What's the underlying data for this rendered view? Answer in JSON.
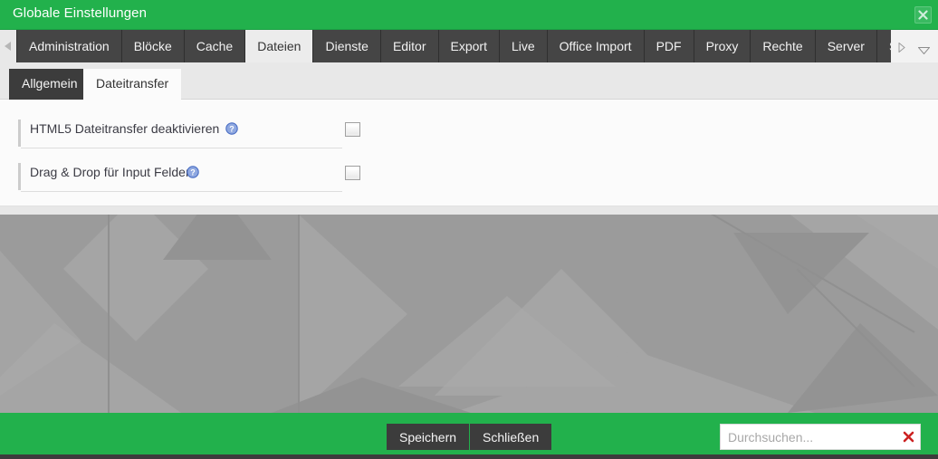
{
  "window": {
    "title": "Globale Einstellungen",
    "close_icon": "close-icon",
    "accent_color": "#22b14c",
    "chrome_color": "#3c3c3c"
  },
  "tabstrip": {
    "scroll_left_icon": "triangle-left-icon",
    "scroll_right_icon": "triangle-right-icon",
    "overflow_icon": "chevron-down-icon",
    "active_tab": "Dateien",
    "tabs": [
      {
        "label": "Administration",
        "active": false
      },
      {
        "label": "Blöcke",
        "active": false
      },
      {
        "label": "Cache",
        "active": false
      },
      {
        "label": "Dateien",
        "active": true
      },
      {
        "label": "Dienste",
        "active": false
      },
      {
        "label": "Editor",
        "active": false
      },
      {
        "label": "Export",
        "active": false
      },
      {
        "label": "Live",
        "active": false
      },
      {
        "label": "Office Import",
        "active": false
      },
      {
        "label": "PDF",
        "active": false
      },
      {
        "label": "Proxy",
        "active": false
      },
      {
        "label": "Rechte",
        "active": false
      },
      {
        "label": "Server",
        "active": false
      },
      {
        "label": "Sitemap",
        "active": false
      }
    ]
  },
  "subtabs": {
    "active_tab": "Dateitransfer",
    "items": [
      {
        "label": "Allgemein",
        "active": false
      },
      {
        "label": "Dateitransfer",
        "active": true
      }
    ]
  },
  "form": {
    "rows": [
      {
        "label": "HTML5 Dateitransfer deaktivieren",
        "help_icon": "help-circle-icon",
        "control": "checkbox",
        "checked": false
      },
      {
        "label": "Drag & Drop für Input Felder",
        "help_icon": "help-circle-icon",
        "control": "checkbox",
        "checked": false
      }
    ]
  },
  "footer": {
    "save_label": "Speichern",
    "close_label": "Schließen",
    "search": {
      "placeholder": "Durchsuchen...",
      "value": "",
      "clear_icon": "clear-x-icon"
    }
  }
}
